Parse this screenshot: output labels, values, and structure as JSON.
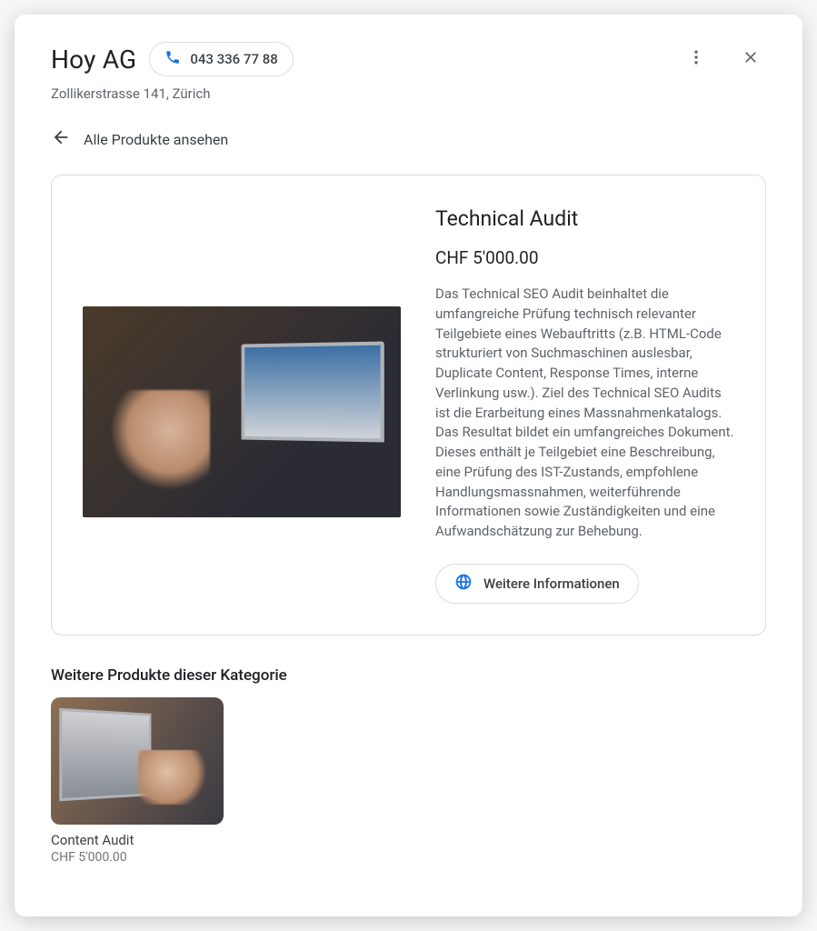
{
  "header": {
    "business_name": "Hoy AG",
    "phone": "043 336 77 88",
    "address": "Zollikerstrasse 141, Zürich"
  },
  "nav": {
    "back_label": "Alle Produkte ansehen"
  },
  "product": {
    "title": "Technical Audit",
    "price": "CHF 5'000.00",
    "description": "Das Technical SEO Audit beinhaltet die umfangreiche Prüfung technisch relevanter Teilgebiete eines Webauftritts (z.B. HTML-Code strukturiert von Suchmaschinen auslesbar, Duplicate Content, Response Times, interne Verlinkung usw.). Ziel des Technical SEO Audits ist die Erarbeitung eines Massnahmenkatalogs. Das Resultat bildet ein umfangreiches Dokument. Dieses enthält je Teilgebiet eine Beschreibung, eine Prüfung des IST-Zustands, empfohlene Handlungsmassnahmen, weiterführende Informationen sowie Zuständigkeiten und eine Aufwandschätzung zur Behebung.",
    "more_info_label": "Weitere Informationen"
  },
  "related": {
    "heading": "Weitere Produkte dieser Kategorie",
    "items": [
      {
        "title": "Content Audit",
        "price": "CHF 5'000.00"
      }
    ]
  },
  "icons": {
    "phone": "phone-icon",
    "more": "more-vert-icon",
    "close": "close-icon",
    "back": "arrow-left-icon",
    "globe": "globe-icon"
  }
}
